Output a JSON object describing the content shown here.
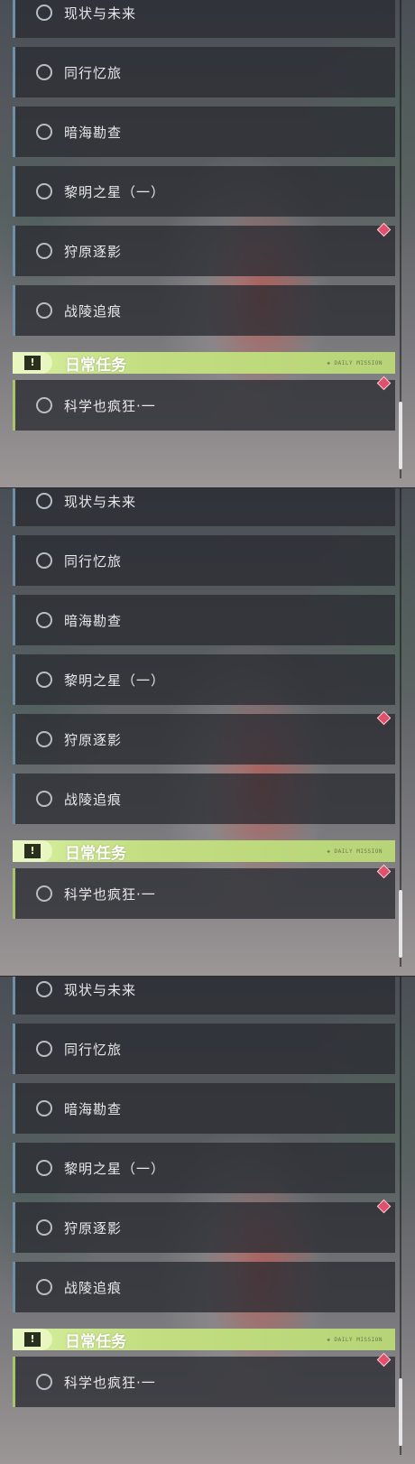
{
  "quests": [
    {
      "label": "现状与未来"
    },
    {
      "label": "同行忆旅"
    },
    {
      "label": "暗海勘查"
    },
    {
      "label": "黎明之星（一）"
    },
    {
      "label": "狩原逐影"
    },
    {
      "label": "战陵追痕"
    }
  ],
  "daily_section": {
    "title": "日常任务",
    "decoration": "◈ DAILY MISSION",
    "quest": "科学也疯狂·一"
  },
  "colors": {
    "accent_green": "#c2de80",
    "marker_red": "#e0506a",
    "row_border_blue": "#6f8fa8"
  }
}
